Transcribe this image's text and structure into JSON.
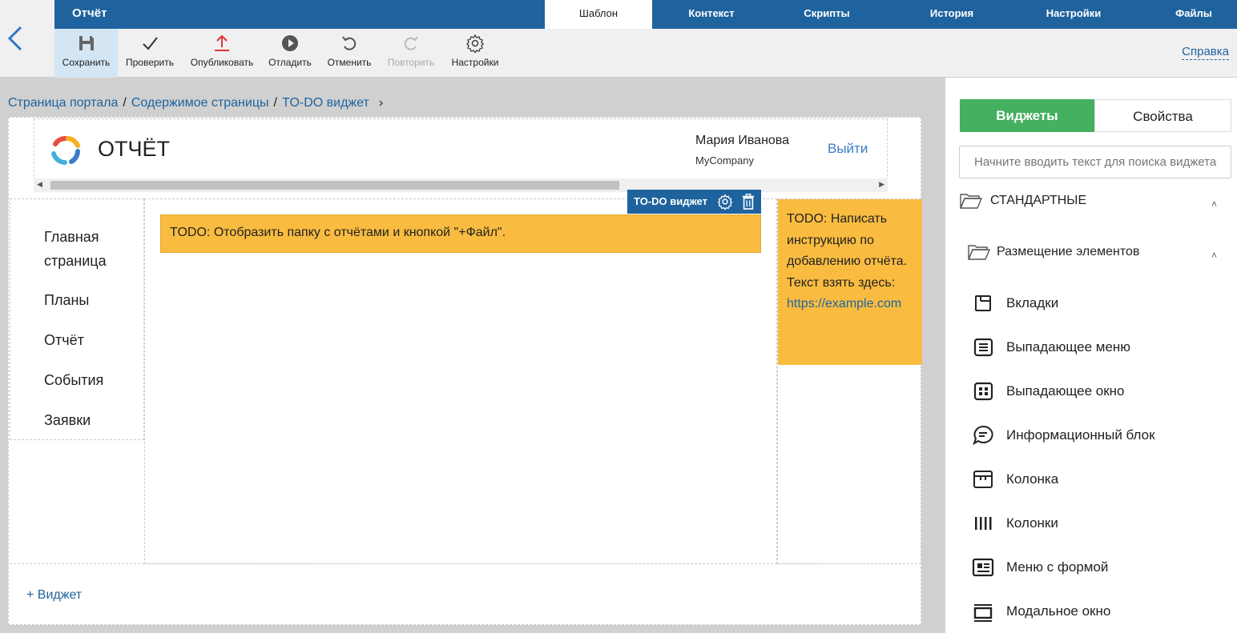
{
  "app": {
    "title": "Отчёт"
  },
  "top_tabs": [
    {
      "label": "Шаблон",
      "active": true
    },
    {
      "label": "Контекст",
      "active": false
    },
    {
      "label": "Скрипты",
      "active": false
    },
    {
      "label": "История",
      "active": false
    },
    {
      "label": "Настройки",
      "active": false
    },
    {
      "label": "Файлы",
      "active": false
    }
  ],
  "toolbar": {
    "save": "Сохранить",
    "check": "Проверить",
    "publish": "Опубликовать",
    "debug": "Отладить",
    "undo": "Отменить",
    "redo": "Повторить",
    "settings": "Настройки",
    "help": "Справка"
  },
  "breadcrumbs": [
    "Страница портала",
    "Содержимое страницы",
    "TO-DO виджет"
  ],
  "portal": {
    "logo_text": "ОТЧЁТ",
    "user_name": "Мария Иванова",
    "company": "MyCompany",
    "logout": "Выйти",
    "nav": [
      "Главная страница",
      "Планы",
      "Отчёт",
      "События",
      "Заявки"
    ],
    "widget_label": "TO-DO виджет",
    "todo_main": "TODO: Отобразить папку с отчётами и кнопкой \"+Файл\".",
    "todo_side_text": "TODO: Написать инструкцию по добавлению отчёта. Текст взять здесь:",
    "todo_side_link": "https://example.com",
    "add_widget": "+ Виджет"
  },
  "panel": {
    "tab_widgets": "Виджеты",
    "tab_properties": "Свойства",
    "search_placeholder": "Начните вводить текст для поиска виджета",
    "section_standard": "СТАНДАРТНЫЕ",
    "subsection_layout": "Размещение элементов",
    "widgets": [
      {
        "label": "Вкладки",
        "icon": "tabs-icon"
      },
      {
        "label": "Выпадающее меню",
        "icon": "dropdown-menu-icon"
      },
      {
        "label": "Выпадающее окно",
        "icon": "dropdown-window-icon"
      },
      {
        "label": "Информационный блок",
        "icon": "info-block-icon"
      },
      {
        "label": "Колонка",
        "icon": "column-icon"
      },
      {
        "label": "Колонки",
        "icon": "columns-icon"
      },
      {
        "label": "Меню с формой",
        "icon": "menu-form-icon"
      },
      {
        "label": "Модальное окно",
        "icon": "modal-icon"
      }
    ]
  },
  "colors": {
    "topbar": "#1f639e",
    "accent_green": "#45b060",
    "todo_yellow": "#f9bc40",
    "link_blue": "#1f639e"
  }
}
